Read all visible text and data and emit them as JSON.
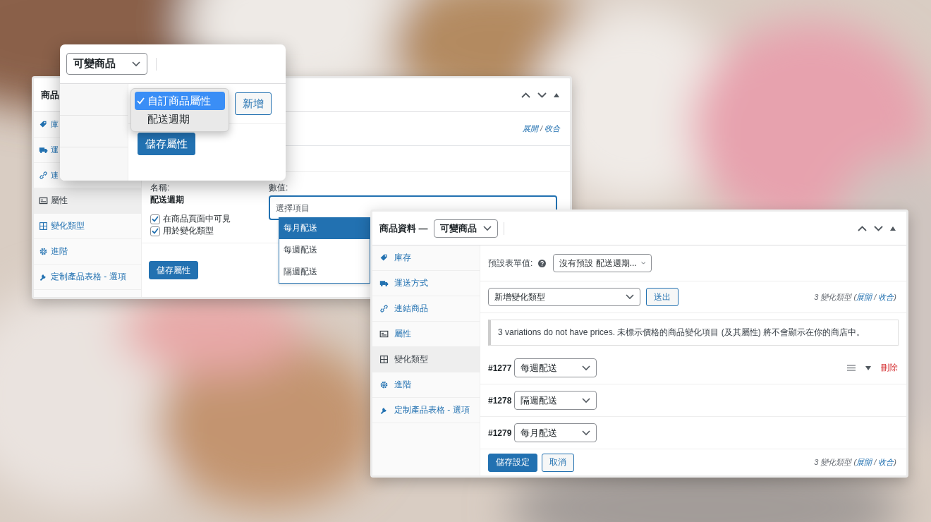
{
  "attributes_panel": {
    "title": "商品",
    "tabs": [
      {
        "label": "庫",
        "selected": false
      },
      {
        "label": "運",
        "selected": false
      },
      {
        "label": "連",
        "selected": false
      },
      {
        "label": "屬性",
        "selected": true
      },
      {
        "label": "變化類型",
        "selected": false
      },
      {
        "label": "進階",
        "selected": false
      },
      {
        "label": "定制產品表格 - 選項",
        "selected": false
      }
    ],
    "toggle": {
      "expand": "展開",
      "separator": "/",
      "collapse": "收合"
    },
    "name_label": "名稱:",
    "name": "配送週期",
    "checkboxes": [
      {
        "label": "在商品頁面中可見",
        "checked": true
      },
      {
        "label": "用於變化類型",
        "checked": true
      }
    ],
    "values_label": "數值:",
    "values_field": {
      "placeholder": "選擇項目"
    },
    "values_options": [
      {
        "label": "每月配送",
        "selected": true
      },
      {
        "label": "每週配送",
        "selected": false
      },
      {
        "label": "隔週配送",
        "selected": false
      }
    ],
    "save_button": "儲存屬性"
  },
  "type_popup": {
    "type_select": "可變商品",
    "attribute_menu": [
      {
        "label": "自訂商品屬性",
        "selected": true
      },
      {
        "label": "配送週期",
        "selected": false
      }
    ],
    "add_button": "新增",
    "save_button": "儲存屬性"
  },
  "variations_panel": {
    "title": "商品資料 —",
    "type_select": "可變商品",
    "tabs": [
      {
        "label": "庫存",
        "selected": false
      },
      {
        "label": "運送方式",
        "selected": false
      },
      {
        "label": "連結商品",
        "selected": false
      },
      {
        "label": "屬性",
        "selected": false
      },
      {
        "label": "變化類型",
        "selected": true
      },
      {
        "label": "進階",
        "selected": false
      },
      {
        "label": "定制產品表格 - 選項",
        "selected": false
      }
    ],
    "default_label": "預設表單值:",
    "default_select": "沒有預設 配送週期...",
    "add_select": "新增變化類型",
    "submit_button": "送出",
    "summary_top": {
      "prefix": "3 變化類型 (",
      "expand": "展開",
      "separator": " / ",
      "collapse": "收合",
      "suffix": ")"
    },
    "notice": "3 variations do not have prices. 未標示價格的商品變化項目 (及其屬性) 將不會顯示在你的商店中。",
    "variations": [
      {
        "id": "#1277",
        "value": "每週配送",
        "delete": "刪除"
      },
      {
        "id": "#1278",
        "value": "隔週配送"
      },
      {
        "id": "#1279",
        "value": "每月配送"
      }
    ],
    "save_button": "儲存設定",
    "cancel_button": "取消",
    "summary_bottom": {
      "prefix": "3 變化類型 (",
      "expand": "展開",
      "separator": " / ",
      "collapse": "收合",
      "suffix": ")"
    }
  }
}
